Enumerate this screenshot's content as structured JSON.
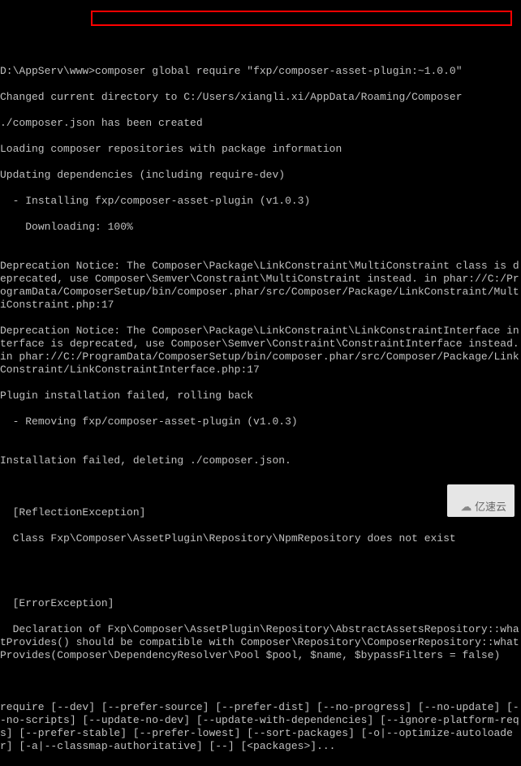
{
  "prompt": {
    "path": "D:\\AppServ\\www",
    "command": "composer global require \"fxp/composer-asset-plugin:~1.0.0\""
  },
  "output": {
    "l01": "Changed current directory to C:/Users/xiangli.xi/AppData/Roaming/Composer",
    "l02": "./composer.json has been created",
    "l03": "Loading composer repositories with package information",
    "l04": "Updating dependencies (including require-dev)",
    "l05": "  - Installing fxp/composer-asset-plugin (v1.0.3)",
    "l06": "    Downloading: 100%",
    "l07": "",
    "l08": "Deprecation Notice: The Composer\\Package\\LinkConstraint\\MultiConstraint class is deprecated, use Composer\\Semver\\Constraint\\MultiConstraint instead. in phar://C:/ProgramData/ComposerSetup/bin/composer.phar/src/Composer/Package/LinkConstraint/MultiConstraint.php:17",
    "l09": "Deprecation Notice: The Composer\\Package\\LinkConstraint\\LinkConstraintInterface interface is deprecated, use Composer\\Semver\\Constraint\\ConstraintInterface instead. in phar://C:/ProgramData/ComposerSetup/bin/composer.phar/src/Composer/Package/LinkConstraint/LinkConstraintInterface.php:17",
    "l10": "Plugin installation failed, rolling back",
    "l11": "  - Removing fxp/composer-asset-plugin (v1.0.3)",
    "l12": "",
    "l13": "Installation failed, deleting ./composer.json.",
    "l14": "",
    "l15": "",
    "l16": "  [ReflectionException]",
    "l17": "  Class Fxp\\Composer\\AssetPlugin\\Repository\\NpmRepository does not exist",
    "l18": "",
    "l19": "",
    "l20": "",
    "l21": "  [ErrorException]",
    "l22": "  Declaration of Fxp\\Composer\\AssetPlugin\\Repository\\AbstractAssetsRepository::whatProvides() should be compatible with Composer\\Repository\\ComposerRepository::whatProvides(Composer\\DependencyResolver\\Pool $pool, $name, $bypassFilters = false)",
    "l23": "",
    "l24": "",
    "l25": "require [--dev] [--prefer-source] [--prefer-dist] [--no-progress] [--no-update] [--no-scripts] [--update-no-dev] [--update-with-dependencies] [--ignore-platform-reqs] [--prefer-stable] [--prefer-lowest] [--sort-packages] [-o|--optimize-autoloader] [-a|--classmap-authoritative] [--] [<packages>]..."
  },
  "watermark": {
    "text": "亿速云"
  }
}
